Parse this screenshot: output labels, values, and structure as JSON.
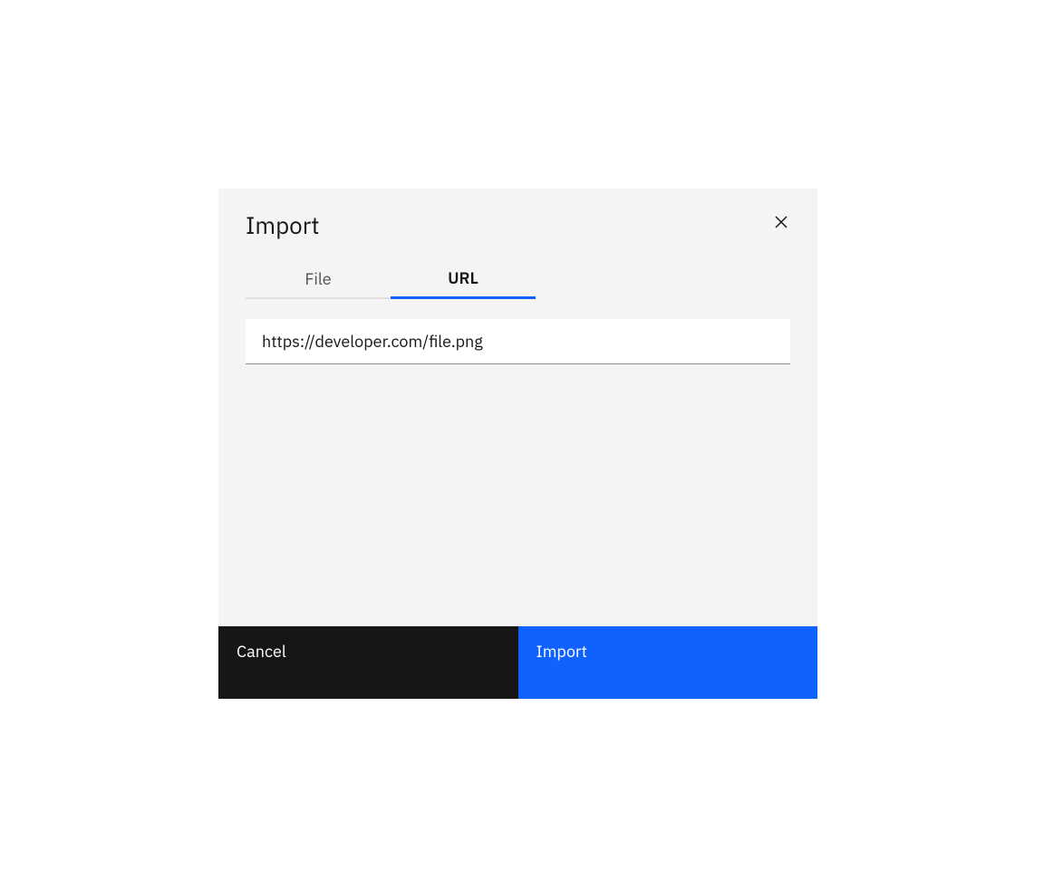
{
  "modal": {
    "title": "Import",
    "tabs": [
      {
        "label": "File",
        "active": false
      },
      {
        "label": "URL",
        "active": true
      }
    ],
    "url_input_value": "https://developer.com/file.png",
    "footer": {
      "cancel_label": "Cancel",
      "import_label": "Import"
    }
  },
  "colors": {
    "primary": "#0f62fe",
    "dark": "#161616",
    "surface": "#f4f4f4"
  }
}
